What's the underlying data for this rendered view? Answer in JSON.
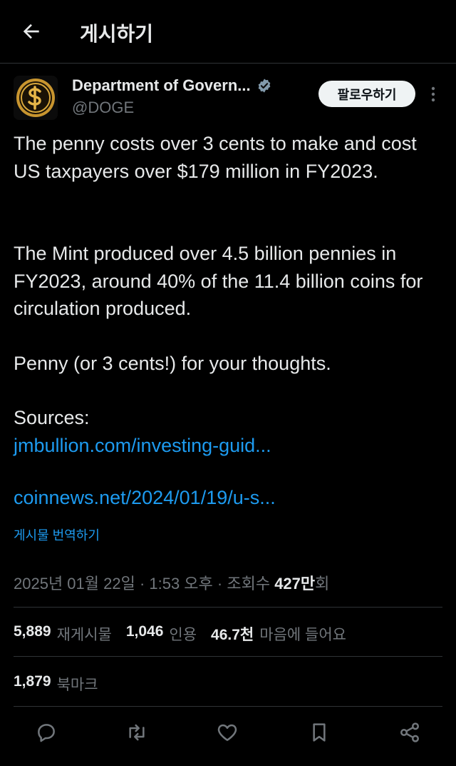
{
  "header": {
    "title": "게시하기"
  },
  "author": {
    "display_name": "Department of Govern...",
    "handle": "@DOGE",
    "follow_label": "팔로우하기"
  },
  "post": {
    "paragraph1": "The penny costs over 3 cents to make and cost US taxpayers over $179 million in FY2023.",
    "paragraph2": "The Mint produced over 4.5 billion pennies in FY2023, around 40% of the 11.4 billion coins for circulation produced.",
    "paragraph3": "Penny (or 3 cents!) for your thoughts.",
    "sources_label": "Sources:",
    "link1": "jmbullion.com/investing-guid...",
    "link2": "coinnews.net/2024/01/19/u-s...",
    "translate_label": "게시물 번역하기"
  },
  "meta": {
    "timestamp": "2025년 01월 22일 · 1:53 오후 · 조회수 ",
    "views_value": "427만",
    "views_suffix": "회"
  },
  "stats": {
    "reposts_value": "5,889",
    "reposts_label": "재게시물",
    "quotes_value": "1,046",
    "quotes_label": "인용",
    "likes_value": "46.7천",
    "likes_label": "마음에 들어요",
    "bookmarks_value": "1,879",
    "bookmarks_label": "북마크"
  },
  "colors": {
    "background": "#000000",
    "link": "#1d9bf0",
    "muted": "#71767b",
    "verified": "#829aab"
  }
}
